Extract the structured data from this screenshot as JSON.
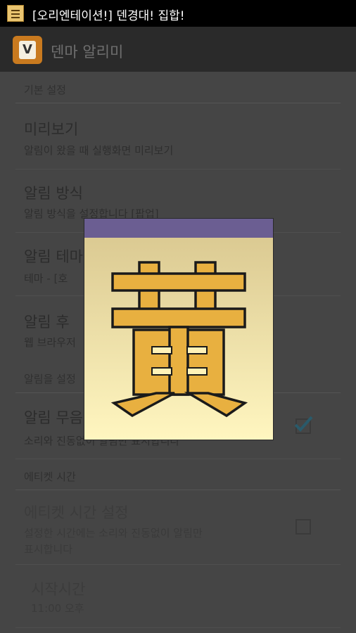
{
  "status_bar": {
    "notification_text": "[오리엔테이션!] 덴경대! 집합!",
    "notification_icon": "hanja-notification-icon"
  },
  "action_bar": {
    "icon_letter": "V",
    "title": "덴마 알리미"
  },
  "sections": [
    {
      "header": "기본 설정"
    },
    {
      "header": "알림을 설정"
    },
    {
      "header": "에티켓 시간"
    }
  ],
  "prefs": {
    "preview": {
      "title": "미리보기",
      "summary": "알림이 왔을 때 실행화면 미리보기"
    },
    "method": {
      "title": "알림 방식",
      "summary": "알림 방식을 설정합니다 [팝업]"
    },
    "theme": {
      "title": "알림 테마",
      "summary": "테마 - [호"
    },
    "after": {
      "title": "알림 후",
      "summary": "웹 브라우저"
    },
    "mute": {
      "title": "알림 무음",
      "summary": "소리와 진동없이 알림만 표시합니다",
      "checked": true
    },
    "etiquette": {
      "title": "에티켓 시간 설정",
      "summary_line1": "설정한 시간에는 소리와 진동없이 알림만",
      "summary_line2": "표시합니다",
      "checked": false
    },
    "start_time": {
      "title": "시작시간",
      "summary": "11:00 오후"
    }
  },
  "dialog": {
    "glyph_name": "hanja-hwang-glyph",
    "colors": {
      "bar": "#6b5e92",
      "glyph_fill": "#e8b040",
      "glyph_stroke": "#1a1a1a"
    }
  },
  "colors": {
    "checkmark": "#2a5a6a"
  }
}
